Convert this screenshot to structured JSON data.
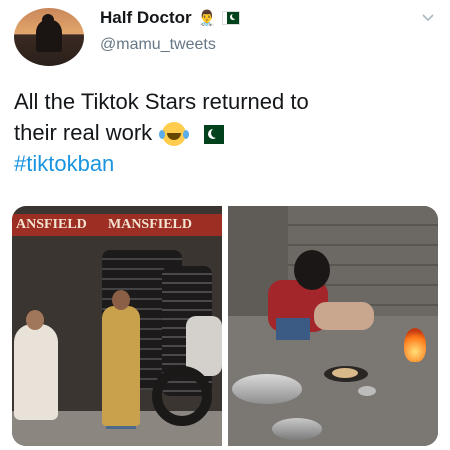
{
  "author": {
    "display_name": "Half Doctor",
    "name_emoji": "👨‍⚕️",
    "name_flag": "pakistan-flag",
    "handle": "@mamu_tweets"
  },
  "tweet": {
    "line1": "All the Tiktok Stars returned to",
    "line2": "their real work",
    "emoji_laugh": "face-with-tears-of-joy",
    "emoji_flag": "pakistan-flag",
    "hashtag": "#tiktokban"
  },
  "media": {
    "left_sign_a": "ANSFIELD",
    "left_sign_b": "MANSFIELD"
  },
  "colors": {
    "hashtag": "#1b95e0",
    "handle": "#657786",
    "text": "#14171a"
  },
  "icons": {
    "menu": "chevron-down-icon"
  }
}
